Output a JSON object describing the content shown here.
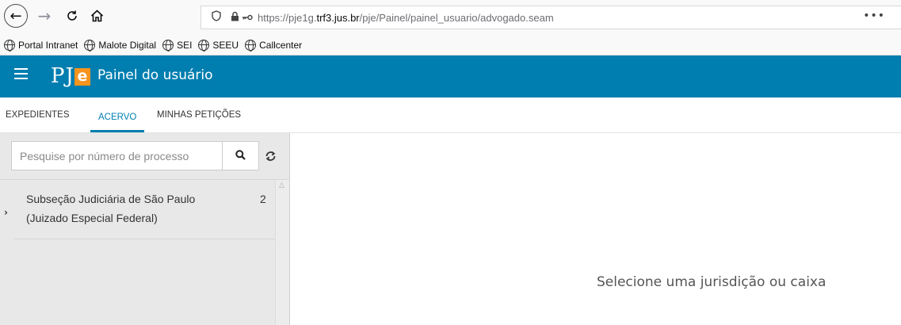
{
  "browser": {
    "url_prefix": "https://pje1g.",
    "url_domain": "trf3.jus.br",
    "url_path": "/pje/Painel/painel_usuario/advogado.seam",
    "more_label": "•••",
    "bookmarks": [
      {
        "label": "Portal Intranet",
        "icon": "globe-icon"
      },
      {
        "label": "Malote Digital",
        "icon": "globe-icon"
      },
      {
        "label": "SEI",
        "icon": "globe-icon"
      },
      {
        "label": "SEEU",
        "icon": "globe-icon"
      },
      {
        "label": "Callcenter",
        "icon": "globe-icon"
      }
    ]
  },
  "app": {
    "logo_p": "P",
    "logo_j": "J",
    "logo_e": "e",
    "title": "Painel do usuário",
    "header_color": "#007eb0",
    "accent_color": "#f7941d"
  },
  "tabs": [
    {
      "label": "EXPEDIENTES",
      "active": false
    },
    {
      "label": "ACERVO",
      "active": true
    },
    {
      "label": "MINHAS PETIÇÕES",
      "active": false
    }
  ],
  "sidebar": {
    "search_placeholder": "Pesquise por número de processo",
    "search_value": "",
    "items": [
      {
        "label_line1": "Subseção Judiciária de São Paulo",
        "label_line2": "(Juizado Especial Federal)",
        "count": "2"
      }
    ]
  },
  "main": {
    "message": "Selecione uma jurisdição ou caixa"
  }
}
